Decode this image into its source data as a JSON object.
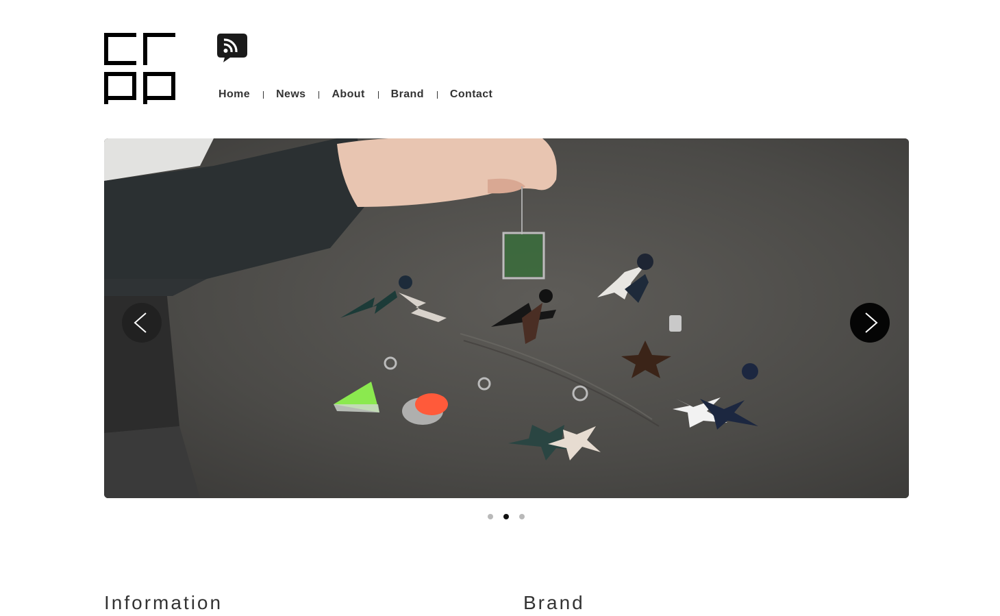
{
  "header": {
    "logo_icon": "crop-logo",
    "rss_icon": "rss-speech-bubble-icon"
  },
  "nav": {
    "items": [
      {
        "label": "Home"
      },
      {
        "label": "News"
      },
      {
        "label": "About"
      },
      {
        "label": "Brand"
      },
      {
        "label": "Contact"
      }
    ]
  },
  "slider": {
    "prev_icon": "chevron-left-icon",
    "next_icon": "chevron-right-icon",
    "slide_count": 3,
    "active_slide": 2
  },
  "sections": {
    "information_title": "Information",
    "brand_title": "Brand"
  },
  "colors": {
    "text": "#333333",
    "logo": "#000000",
    "dot_active": "#111111",
    "dot_inactive": "#b9b9b9"
  }
}
